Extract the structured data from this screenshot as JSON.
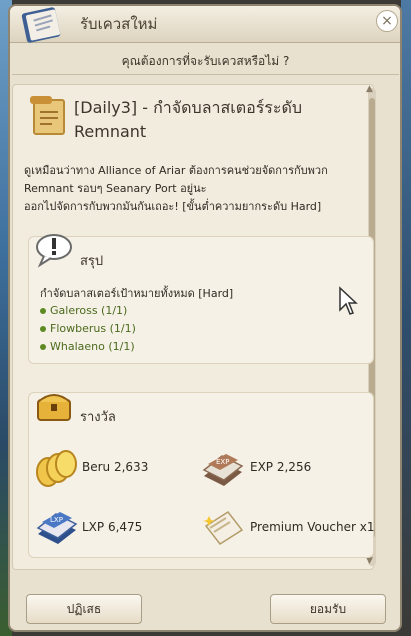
{
  "window": {
    "title": "รับเควสใหม่",
    "close_label": "×"
  },
  "prompt": "คุณต้องการที่จะรับเควสหรือไม่ ?",
  "quest": {
    "title_line1": "[Daily3] - กำจัดบลาสเตอร์ระดับ",
    "title_line2": "Remnant",
    "description": [
      "ดูเหมือนว่าทาง Alliance of Ariar ต้องการคนช่วยจัดการกับพวก",
      "Remnant รอบๆ Seanary Port อยู่นะ",
      "ออกไปจัดการกับพวกมันกันเถอะ! [ขั้นต่ำความยากระดับ Hard]"
    ]
  },
  "summary": {
    "heading": "สรุป",
    "objective": "กำจัดบลาสเตอร์เป้าหมายทั้งหมด [Hard]",
    "targets": [
      "Galeross (1/1)",
      "Flowberus (1/1)",
      "Whalaeno (1/1)"
    ]
  },
  "rewards": {
    "heading": "รางวัล",
    "items": [
      {
        "icon": "beru-coin-icon",
        "label": "Beru 2,633"
      },
      {
        "icon": "exp-book-icon",
        "label": "EXP 2,256"
      },
      {
        "icon": "lxp-book-icon",
        "label": "LXP 6,475"
      },
      {
        "icon": "premium-voucher-icon",
        "label": "Premium Voucher x1"
      }
    ]
  },
  "buttons": {
    "decline": "ปฏิเสธ",
    "accept": "ยอมรับ"
  },
  "colors": {
    "panel_bg": "#f2ecdf",
    "target_green": "#4a6a1d",
    "accent_gold": "#e7b23a"
  }
}
